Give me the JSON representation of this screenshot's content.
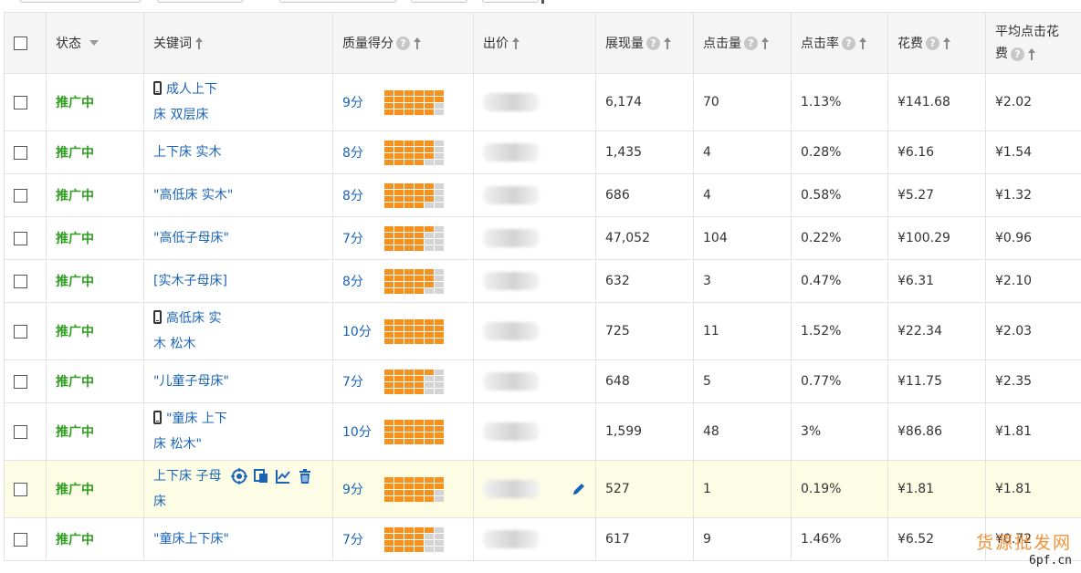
{
  "headers": {
    "status": "状态",
    "keyword": "关键词",
    "quality": "质量得分",
    "bid": "出价",
    "impressions": "展现量",
    "clicks": "点击量",
    "ctr": "点击率",
    "cost": "花费",
    "cpc_line1": "平均点击花",
    "cpc_line2": "费"
  },
  "help_glyph": "?",
  "rows": [
    {
      "status": "推广中",
      "mobile": true,
      "kw1": "成人上下",
      "kw2": "床 双层床",
      "score": "9分",
      "score_value": 9,
      "impr": "6,174",
      "clicks": "70",
      "ctr": "1.13%",
      "cost": "¥141.68",
      "cpc": "¥2.02"
    },
    {
      "status": "推广中",
      "mobile": false,
      "kw1": "上下床 实木",
      "kw2": "",
      "score": "8分",
      "score_value": 8,
      "impr": "1,435",
      "clicks": "4",
      "ctr": "0.28%",
      "cost": "¥6.16",
      "cpc": "¥1.54"
    },
    {
      "status": "推广中",
      "mobile": false,
      "kw1": "\"高低床 实木\"",
      "kw2": "",
      "score": "8分",
      "score_value": 8,
      "impr": "686",
      "clicks": "4",
      "ctr": "0.58%",
      "cost": "¥5.27",
      "cpc": "¥1.32"
    },
    {
      "status": "推广中",
      "mobile": false,
      "kw1": "\"高低子母床\"",
      "kw2": "",
      "score": "7分",
      "score_value": 7,
      "impr": "47,052",
      "clicks": "104",
      "ctr": "0.22%",
      "cost": "¥100.29",
      "cpc": "¥0.96"
    },
    {
      "status": "推广中",
      "mobile": false,
      "kw1": "[实木子母床]",
      "kw2": "",
      "score": "8分",
      "score_value": 8,
      "impr": "632",
      "clicks": "3",
      "ctr": "0.47%",
      "cost": "¥6.31",
      "cpc": "¥2.10"
    },
    {
      "status": "推广中",
      "mobile": true,
      "kw1": "高低床 实",
      "kw2": "木 松木",
      "score": "10分",
      "score_value": 10,
      "impr": "725",
      "clicks": "11",
      "ctr": "1.52%",
      "cost": "¥22.34",
      "cpc": "¥2.03"
    },
    {
      "status": "推广中",
      "mobile": false,
      "kw1": "\"儿童子母床\"",
      "kw2": "",
      "score": "7分",
      "score_value": 7,
      "impr": "648",
      "clicks": "5",
      "ctr": "0.77%",
      "cost": "¥11.75",
      "cpc": "¥2.35"
    },
    {
      "status": "推广中",
      "mobile": true,
      "kw1": "\"童床 上下",
      "kw2": "床 松木\"",
      "score": "10分",
      "score_value": 10,
      "impr": "1,599",
      "clicks": "48",
      "ctr": "3%",
      "cost": "¥86.86",
      "cpc": "¥1.81"
    },
    {
      "status": "推广中",
      "mobile": false,
      "kw1": "上下床 子母",
      "kw2": "床",
      "score": "9分",
      "score_value": 9,
      "impr": "527",
      "clicks": "1",
      "ctr": "0.19%",
      "cost": "¥1.81",
      "cpc": "¥1.81",
      "highlight": true
    },
    {
      "status": "推广中",
      "mobile": false,
      "kw1": "\"童床上下床\"",
      "kw2": "",
      "score": "7分",
      "score_value": 7,
      "impr": "617",
      "clicks": "9",
      "ctr": "1.46%",
      "cost": "¥6.52",
      "cpc": "¥0.72"
    }
  ],
  "watermark": {
    "line1": "货源批发网",
    "line2": "6pf.cn"
  },
  "colors": {
    "status_green": "#2e9e1f",
    "link_blue": "#1a64b8",
    "score_orange": "#f7911e",
    "score_gray": "#d4d4d4",
    "highlight_row": "#fdfde6"
  }
}
